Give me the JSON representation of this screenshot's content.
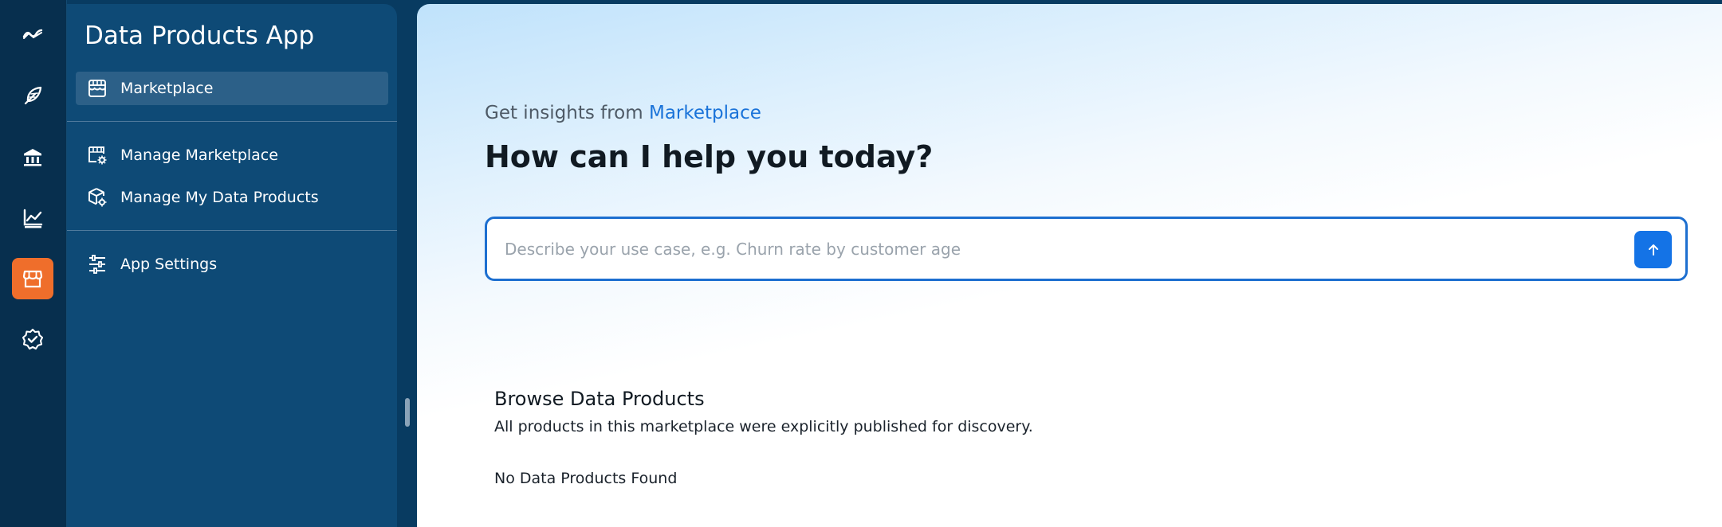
{
  "rail": {
    "items": [
      {
        "icon": "analytics-logo-icon"
      },
      {
        "icon": "feather-icon"
      },
      {
        "icon": "bank-icon"
      },
      {
        "icon": "chart-icon"
      },
      {
        "icon": "marketplace-icon",
        "active": true
      },
      {
        "icon": "verified-badge-icon"
      }
    ],
    "active_color": "#ef6e2b"
  },
  "sidebar": {
    "title": "Data Products App",
    "items": [
      {
        "label": "Marketplace",
        "icon": "store-icon",
        "selected": true
      },
      {
        "label": "Manage Marketplace",
        "icon": "store-settings-icon"
      },
      {
        "label": "Manage My Data Products",
        "icon": "package-settings-icon"
      },
      {
        "label": "App Settings",
        "icon": "sliders-icon"
      }
    ]
  },
  "main": {
    "insights_prefix": "Get insights from",
    "insights_link": "Marketplace",
    "headline": "How can I help you today?",
    "prompt": {
      "value": "",
      "placeholder": "Describe your use case, e.g. Churn rate by customer age"
    },
    "browse": {
      "title": "Browse Data Products",
      "subtitle": "All products in this marketplace were explicitly published for discovery.",
      "empty_message": "No Data Products Found"
    }
  },
  "colors": {
    "accent": "#1473e6",
    "rail_bg": "#072f4e",
    "sidebar_bg": "#0e4a76"
  }
}
